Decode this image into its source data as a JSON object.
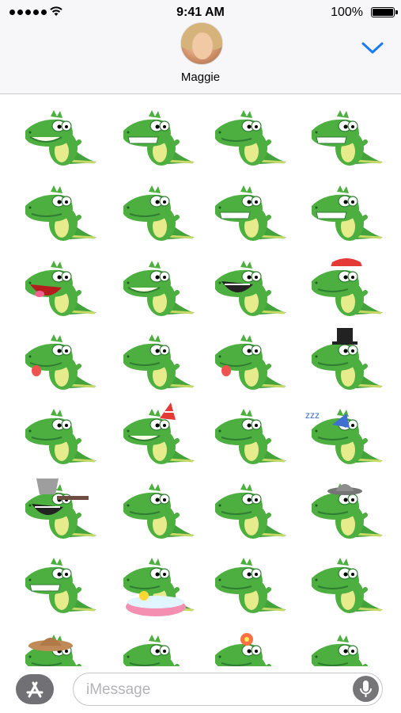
{
  "status_bar": {
    "time": "9:41 AM",
    "battery_percent": "100%",
    "signal_icon": "signal-dots-icon",
    "wifi_icon": "wifi-icon",
    "battery_icon": "battery-icon"
  },
  "header": {
    "contact_name": "Maggie",
    "collapse_icon": "chevron-down-icon",
    "accent_color": "#1a7cf5"
  },
  "sticker_grid": {
    "columns": 4,
    "visible_rows": 8,
    "stickers": [
      "crocodile-sticker-1",
      "crocodile-sticker-2",
      "crocodile-sticker-3",
      "crocodile-sticker-4",
      "crocodile-sticker-5",
      "crocodile-sticker-6",
      "crocodile-sticker-7",
      "crocodile-sticker-8",
      "crocodile-sticker-9",
      "crocodile-sticker-10",
      "crocodile-sticker-11",
      "crocodile-sticker-12",
      "crocodile-sticker-13",
      "crocodile-sticker-14",
      "crocodile-sticker-15",
      "crocodile-sticker-16",
      "crocodile-sticker-17",
      "crocodile-sticker-18",
      "crocodile-sticker-19",
      "crocodile-sticker-20",
      "crocodile-sticker-21",
      "crocodile-sticker-22",
      "crocodile-sticker-23",
      "crocodile-sticker-24",
      "crocodile-sticker-25",
      "crocodile-sticker-26",
      "crocodile-sticker-27",
      "crocodile-sticker-28",
      "crocodile-sticker-29",
      "crocodile-sticker-30",
      "crocodile-sticker-31",
      "crocodile-sticker-32"
    ]
  },
  "input_bar": {
    "placeholder": "iMessage",
    "app_store_icon": "app-store-icon",
    "mic_icon": "microphone-icon"
  }
}
